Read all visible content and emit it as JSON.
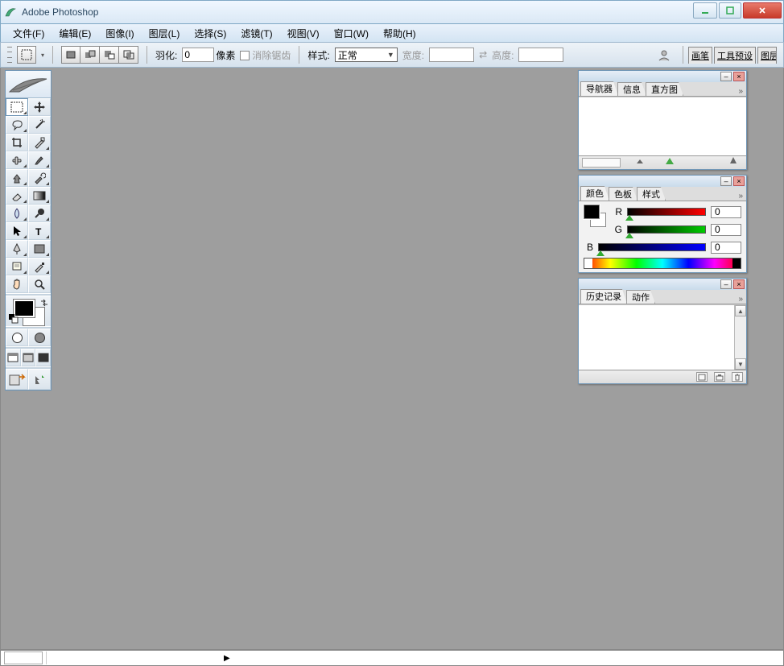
{
  "app": {
    "title": "Adobe Photoshop"
  },
  "menu": {
    "file": "文件(F)",
    "edit": "编辑(E)",
    "image": "图像(I)",
    "layer": "图层(L)",
    "select": "选择(S)",
    "filter": "滤镜(T)",
    "view": "视图(V)",
    "window": "窗口(W)",
    "help": "帮助(H)"
  },
  "options": {
    "feather_label": "羽化:",
    "feather_value": "0",
    "feather_unit": "像素",
    "antialias_label": "消除锯齿",
    "style_label": "样式:",
    "style_value": "正常",
    "width_label": "宽度:",
    "width_value": "",
    "height_label": "高度:",
    "height_value": ""
  },
  "right_tabs": {
    "brushes": "画笔",
    "tool_presets": "工具预设",
    "layer_comps": "图层复合"
  },
  "panels": {
    "navigator": {
      "tabs": [
        "导航器",
        "信息",
        "直方图"
      ]
    },
    "color": {
      "tabs": [
        "颜色",
        "色板",
        "样式"
      ],
      "r_label": "R",
      "g_label": "G",
      "b_label": "B",
      "r": "0",
      "g": "0",
      "b": "0"
    },
    "history": {
      "tabs": [
        "历史记录",
        "动作"
      ]
    }
  },
  "expand_glyph": "»"
}
